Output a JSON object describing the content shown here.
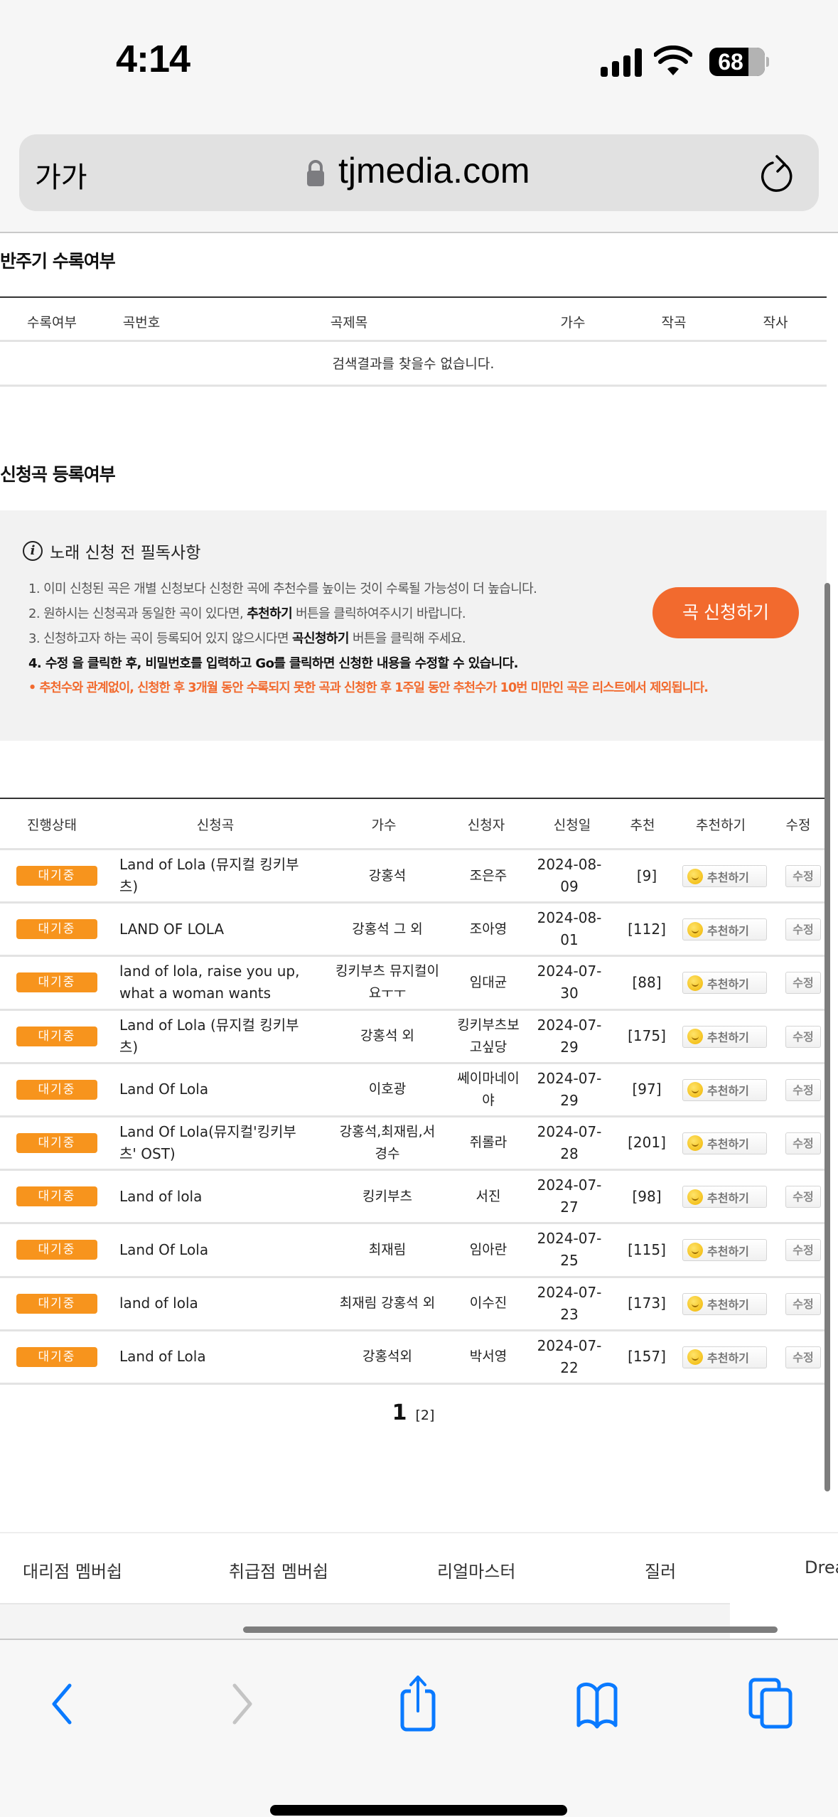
{
  "status_bar": {
    "time": "4:14",
    "battery": "68"
  },
  "browser": {
    "text_size_label": "가가",
    "domain": "tjmedia.com",
    "icons": [
      "lock-icon",
      "reload-icon",
      "back-icon",
      "forward-icon",
      "share-icon",
      "bookmarks-icon",
      "tabs-icon"
    ]
  },
  "accompaniment_section": {
    "title": "반주기 수록여부",
    "columns": [
      "수록여부",
      "곡번호",
      "곡제목",
      "가수",
      "작곡",
      "작사"
    ],
    "empty_message": "검색결과를 찾을수 없습니다."
  },
  "request_section": {
    "title": "신청곡 등록여부",
    "notice": {
      "title": "노래 신청 전 필독사항",
      "items": [
        {
          "text": "1. 이미 신청된 곡은 개별 신청보다 신청한 곡에 추천수를 높이는 것이 수록될 가능성이 더 높습니다."
        },
        {
          "pre": "2. 원하시는 신청곡과 동일한 곡이 있다면, ",
          "bold": "추천하기",
          "post": " 버튼을 클릭하여주시기 바랍니다."
        },
        {
          "pre": "3. 신청하고자 하는 곡이 등록되어 있지 않으시다면 ",
          "bold": "곡신청하기",
          "post": " 버튼을 클릭해 주세요."
        },
        {
          "text": "4. 수정 을 클릭한 후, 비밀번호를 입력하고 Go를 클릭하면 신청한 내용을 수정할 수 있습니다."
        }
      ],
      "warning": "• 추천수와 관계없이, 신청한 후 3개월 동안 수록되지 못한 곡과 신청한 후 1주일 동안 추천수가 10번 미만인 곡은 리스트에서 제외됩니다.",
      "apply_button": "곡 신청하기"
    },
    "columns": [
      "진행상태",
      "신청곡",
      "가수",
      "신청자",
      "신청일",
      "추천",
      "추천하기",
      "수정"
    ],
    "recommend_label": "추천하기",
    "edit_label": "수정",
    "status_color": "#f7941d",
    "rows": [
      {
        "status": "대기중",
        "song": "Land of Lola (뮤지컬 킹키부츠)",
        "singer": "강홍석",
        "requester": "조은주",
        "date": "2024-08-09",
        "recommends": "[9]"
      },
      {
        "status": "대기중",
        "song": "LAND OF LOLA",
        "singer": "강홍석 그 외",
        "requester": "조아영",
        "date": "2024-08-01",
        "recommends": "[112]"
      },
      {
        "status": "대기중",
        "song": "land of lola, raise you up, what a woman wants",
        "singer": "킹키부츠 뮤지컬이요ㅜㅜ",
        "requester": "임대균",
        "date": "2024-07-30",
        "recommends": "[88]"
      },
      {
        "status": "대기중",
        "song": "Land of Lola (뮤지컬 킹키부츠)",
        "singer": "강홍석 외",
        "requester": "킹키부츠보고싶당",
        "date": "2024-07-29",
        "recommends": "[175]"
      },
      {
        "status": "대기중",
        "song": "Land Of Lola",
        "singer": "이호광",
        "requester": "쎄이마네이야",
        "date": "2024-07-29",
        "recommends": "[97]"
      },
      {
        "status": "대기중",
        "song": "Land Of Lola(뮤지컬'킹키부츠' OST)",
        "singer": "강홍석,최재림,서경수",
        "requester": "쥐롤라",
        "date": "2024-07-28",
        "recommends": "[201]"
      },
      {
        "status": "대기중",
        "song": "Land of lola",
        "singer": "킹키부츠",
        "requester": "서진",
        "date": "2024-07-27",
        "recommends": "[98]"
      },
      {
        "status": "대기중",
        "song": "Land Of Lola",
        "singer": "최재림",
        "requester": "임아란",
        "date": "2024-07-25",
        "recommends": "[115]"
      },
      {
        "status": "대기중",
        "song": "land of lola",
        "singer": "최재림 강홍석 외",
        "requester": "이수진",
        "date": "2024-07-23",
        "recommends": "[173]"
      },
      {
        "status": "대기중",
        "song": "Land of Lola",
        "singer": "강홍석외",
        "requester": "박서영",
        "date": "2024-07-22",
        "recommends": "[157]"
      }
    ],
    "pagination": {
      "current": "1",
      "other": "[2]"
    }
  },
  "footer_nav": [
    "대리점 멤버쉽",
    "취급점 멤버쉽",
    "리얼마스터",
    "질러",
    "Drea"
  ],
  "colors": {
    "accent_orange": "#f26a2e",
    "ios_blue": "#0a7aff"
  }
}
